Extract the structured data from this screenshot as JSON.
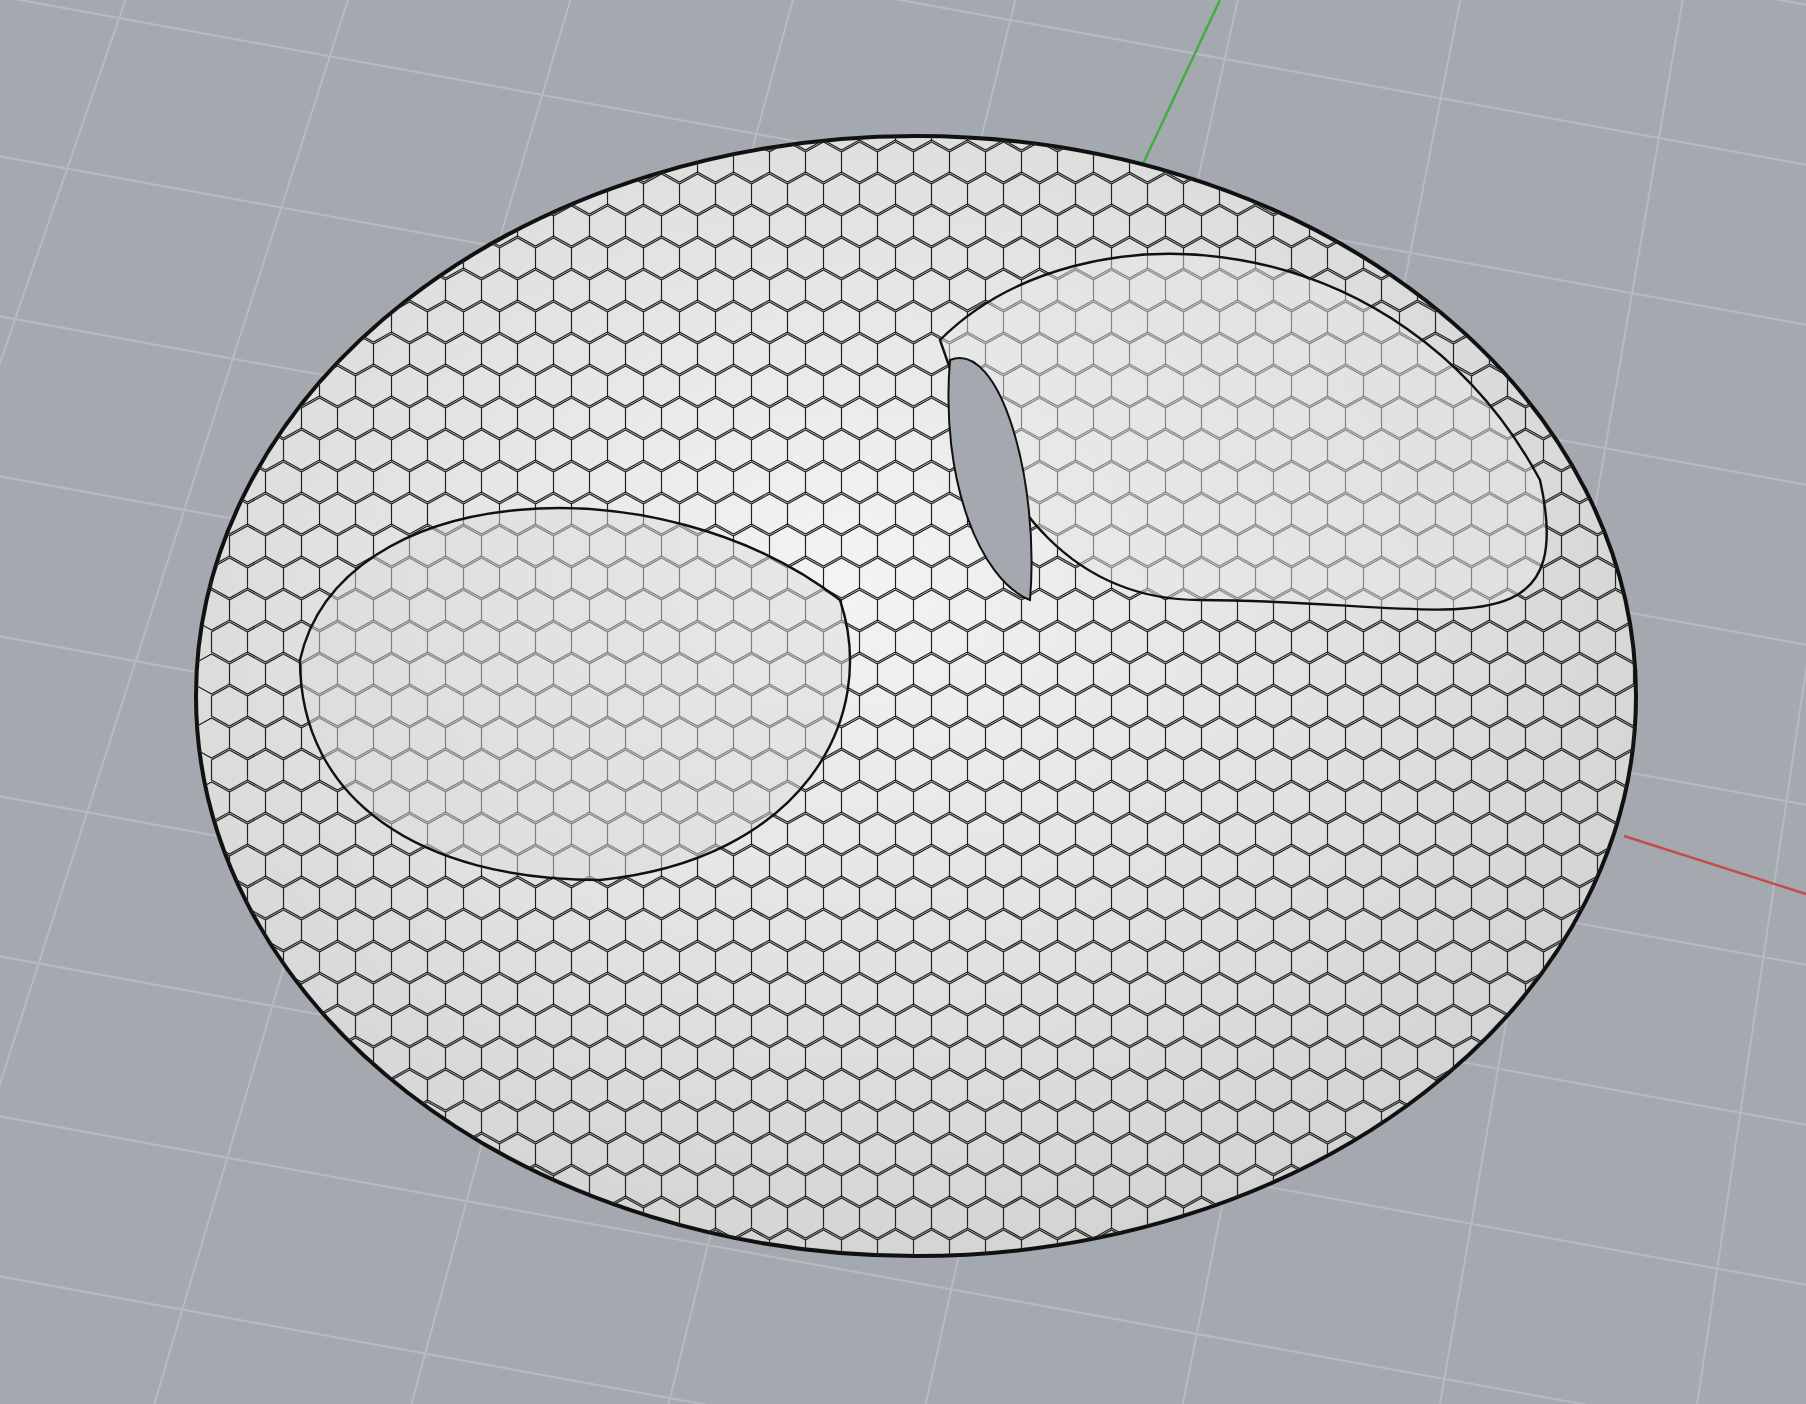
{
  "viewport": {
    "axes": [
      {
        "color": "#3fae3f"
      },
      {
        "color": "#c84a4a"
      }
    ]
  }
}
